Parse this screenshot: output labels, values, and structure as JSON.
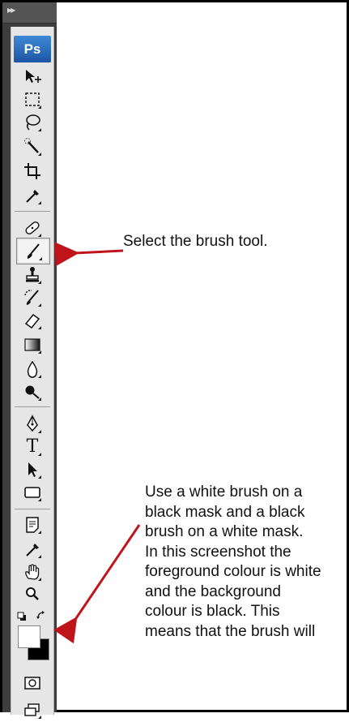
{
  "app": {
    "logo_text": "Ps"
  },
  "toolbar": {
    "tools": [
      {
        "name": "move-tool",
        "icon": "move-icon"
      },
      {
        "name": "marquee-tool",
        "icon": "marquee-icon"
      },
      {
        "name": "lasso-tool",
        "icon": "lasso-icon"
      },
      {
        "name": "quick-selection-tool",
        "icon": "magic-wand-icon"
      },
      {
        "name": "crop-tool",
        "icon": "crop-icon"
      },
      {
        "name": "eyedropper-tool",
        "icon": "eyedropper-icon"
      },
      {
        "name": "spot-healing-tool",
        "icon": "bandage-icon"
      },
      {
        "name": "brush-tool",
        "icon": "brush-icon",
        "selected": true
      },
      {
        "name": "clone-stamp-tool",
        "icon": "stamp-icon"
      },
      {
        "name": "history-brush-tool",
        "icon": "history-brush-icon"
      },
      {
        "name": "eraser-tool",
        "icon": "eraser-icon"
      },
      {
        "name": "gradient-tool",
        "icon": "gradient-icon"
      },
      {
        "name": "blur-tool",
        "icon": "droplet-icon"
      },
      {
        "name": "dodge-tool",
        "icon": "dodge-icon"
      },
      {
        "name": "pen-tool",
        "icon": "pen-icon"
      },
      {
        "name": "type-tool",
        "icon": "type-icon",
        "label": "T"
      },
      {
        "name": "path-selection-tool",
        "icon": "arrow-icon"
      },
      {
        "name": "shape-tool",
        "icon": "rectangle-icon"
      },
      {
        "name": "notes-tool",
        "icon": "note-icon"
      },
      {
        "name": "eyedropper-3d-tool",
        "icon": "eyedropper-icon"
      },
      {
        "name": "hand-tool",
        "icon": "hand-icon"
      },
      {
        "name": "zoom-tool",
        "icon": "magnifier-icon"
      }
    ],
    "foreground_color": "#ffffff",
    "background_color": "#000000"
  },
  "callouts": {
    "brush": "Select the brush tool.",
    "mask_lines": [
      "Use a white brush on a",
      "black mask and a black",
      "brush on a white mask.",
      "In this screenshot the",
      "foreground colour is white",
      "and the background",
      "colour is black. This",
      "means that the brush will"
    ]
  },
  "colors": {
    "arrow": "#c0141b",
    "toolbar_bg": "#3d3d3d",
    "ps_logo": "#2a6ebf"
  }
}
